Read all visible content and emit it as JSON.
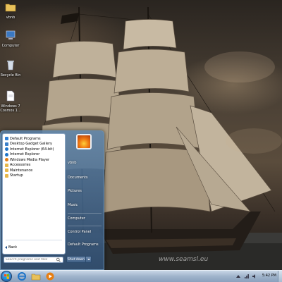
{
  "desktop": {
    "icons": [
      {
        "label": "vbnb",
        "icon": "folder-icon"
      },
      {
        "label": "Computer",
        "icon": "computer-icon"
      },
      {
        "label": "Recycle Bin",
        "icon": "recycle-bin-icon"
      },
      {
        "label": "Windows 7 Cosmos 1...",
        "icon": "document-icon"
      }
    ],
    "watermark": "www.seamsl.eu"
  },
  "start_menu": {
    "programs": [
      {
        "label": "Default Programs",
        "icon": "default-programs-icon",
        "color": "#2f7fd6"
      },
      {
        "label": "Desktop Gadget Gallery",
        "icon": "gadget-icon",
        "color": "#3a7fc9"
      },
      {
        "label": "Internet Explorer (64-bit)",
        "icon": "internet-explorer-icon",
        "color": "#1e74c8"
      },
      {
        "label": "Internet Explorer",
        "icon": "internet-explorer-icon",
        "color": "#1e74c8"
      },
      {
        "label": "Windows Media Player",
        "icon": "media-player-icon",
        "color": "#e67e12"
      },
      {
        "label": "Accessories",
        "icon": "folder-icon",
        "color": "#e8b84a"
      },
      {
        "label": "Maintenance",
        "icon": "folder-icon",
        "color": "#e8b84a"
      },
      {
        "label": "Startup",
        "icon": "folder-icon",
        "color": "#e8b84a"
      }
    ],
    "back_label": "Back",
    "search_placeholder": "Search programs and files",
    "right_links": [
      {
        "label": "vbnb"
      },
      {
        "label": "Documents"
      },
      {
        "label": "Pictures"
      },
      {
        "label": "Music"
      },
      {
        "label": "Computer"
      },
      {
        "label": "Control Panel"
      },
      {
        "label": "Default Programs"
      }
    ],
    "shutdown_label": "Shut down"
  },
  "taskbar": {
    "pinned": [
      {
        "icon": "internet-explorer-icon"
      },
      {
        "icon": "windows-explorer-icon"
      },
      {
        "icon": "media-player-icon"
      }
    ],
    "clock": "5:42 PM"
  }
}
